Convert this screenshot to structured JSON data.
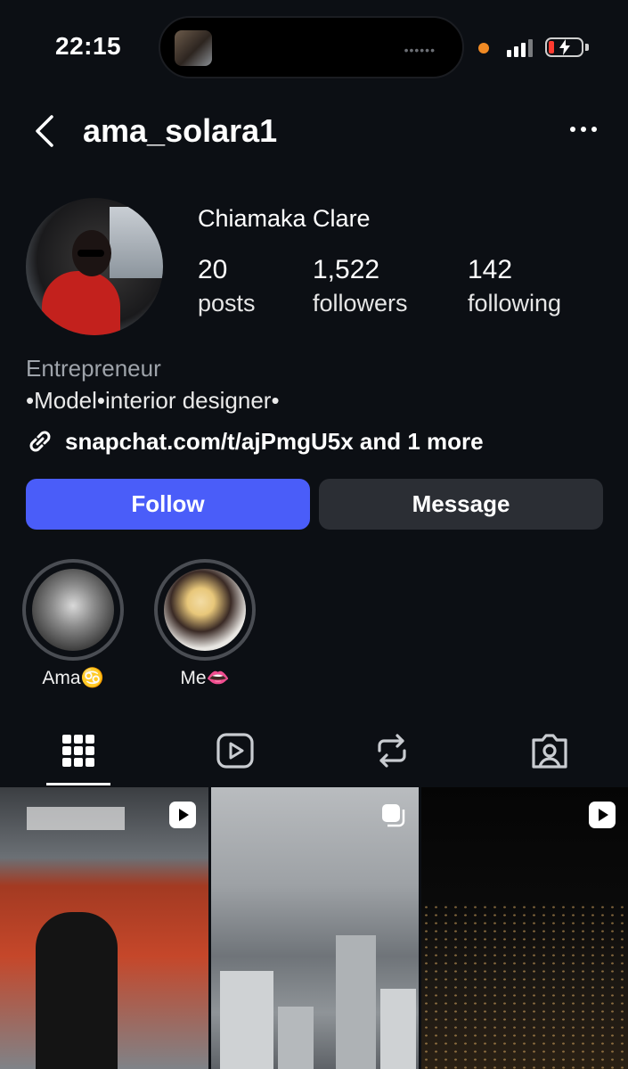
{
  "status_bar": {
    "time": "22:15",
    "island_dots": "••••••"
  },
  "header": {
    "username": "ama_solara1"
  },
  "profile": {
    "full_name": "Chiamaka Clare",
    "stats": [
      {
        "value": "20",
        "label": "posts"
      },
      {
        "value": "1,522",
        "label": "followers"
      },
      {
        "value": "142",
        "label": "following"
      }
    ],
    "category": "Entrepreneur",
    "bio": "•Model•interior designer•",
    "link": "snapchat.com/t/ajPmgU5x and 1 more"
  },
  "actions": {
    "follow_label": "Follow",
    "message_label": "Message"
  },
  "highlights": [
    {
      "label": "Ama♋️"
    },
    {
      "label": "Me👄"
    }
  ],
  "tabs": [
    "grid-icon",
    "reels-icon",
    "reposts-icon",
    "tagged-icon"
  ],
  "colors": {
    "background": "#0c0f14",
    "follow_button": "#4a5df9",
    "message_button": "#2b2e34"
  }
}
